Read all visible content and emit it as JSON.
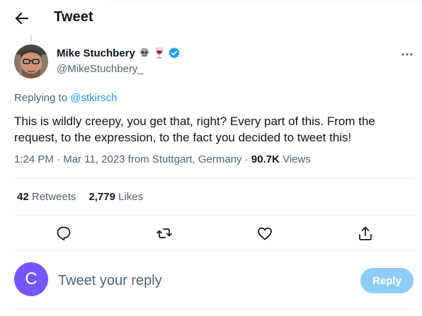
{
  "header": {
    "title": "Tweet",
    "back_icon": "arrow-left-icon"
  },
  "author": {
    "name": "Mike Stuchbery",
    "handle": "@MikeStuchbery_",
    "name_emojis": [
      "skull-emoji",
      "wine-glass-emoji"
    ],
    "verified_icon": "verified-badge-icon",
    "verified_color": "#1d9bf0"
  },
  "reply_context": {
    "prefix": "Replying to ",
    "mention": "@stkirsch"
  },
  "tweet": {
    "text": "This is wildly creepy, you get that, right? Every part of this. From the request, to the expression, to the fact you decided to tweet this!",
    "time": "1:24 PM",
    "date": "Mar 11, 2023",
    "location": "from Stuttgart, Germany",
    "separator": " · ",
    "views_count": "90.7K",
    "views_label": " Views"
  },
  "stats": {
    "retweets_count": "42",
    "retweets_label": " Retweets",
    "likes_count": "2,779",
    "likes_label": " Likes"
  },
  "actions": [
    "reply-icon",
    "retweet-icon",
    "like-icon",
    "share-icon"
  ],
  "composer": {
    "avatar_letter": "C",
    "avatar_color": "#7856ff",
    "placeholder": "Tweet your reply",
    "reply_button": "Reply",
    "reply_button_color": "#8ecdf8"
  },
  "colors": {
    "accent": "#1d9bf0",
    "secondary_text": "#536471",
    "divider": "#eff3f4"
  }
}
